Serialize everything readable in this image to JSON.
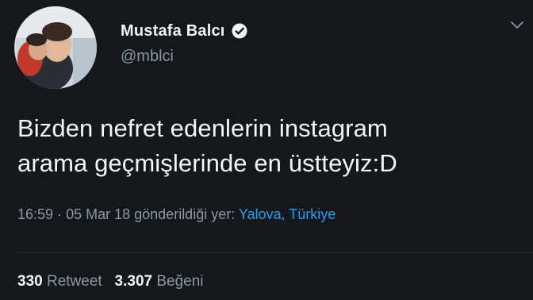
{
  "user": {
    "display_name": "Mustafa Balcı",
    "handle": "@mblci",
    "verified": true
  },
  "tweet": {
    "text_line1": "Bizden nefret edenlerin instagram",
    "text_line2": "arama geçmişlerinde en üstteyiz:D",
    "time": "16:59",
    "separator": "·",
    "date": "05 Mar 18",
    "location_prefix": "gönderildiği yer:",
    "location": "Yalova, Türkiye"
  },
  "stats": {
    "retweet_count": "330",
    "retweet_label": "Retweet",
    "like_count": "3.307",
    "like_label": "Beğeni"
  },
  "icons": {
    "verified": "verified-badge-icon",
    "menu": "chevron-down-icon"
  },
  "colors": {
    "background": "#14171c",
    "text": "#f5f8fa",
    "muted": "#8899a6",
    "link": "#1da1f2"
  }
}
